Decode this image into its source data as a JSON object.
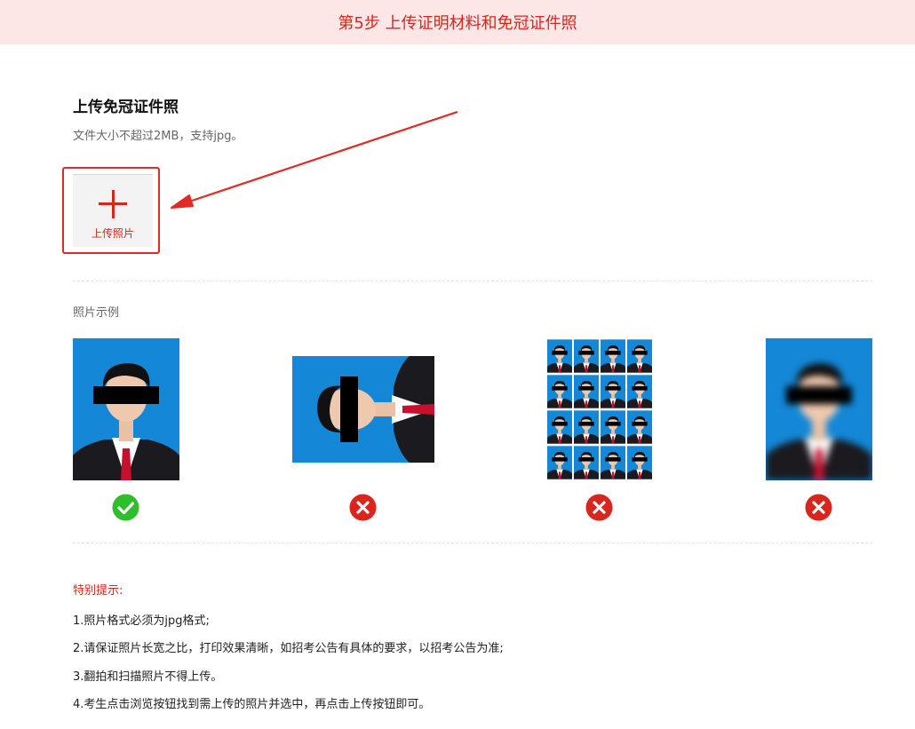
{
  "banner": {
    "title": "第5步 上传证明材料和免冠证件照"
  },
  "upload_section": {
    "title": "上传免冠证件照",
    "subtitle": "文件大小不超过2MB，支持jpg。",
    "upload_button_label": "上传照片",
    "plus_icon": "plus-icon"
  },
  "examples": {
    "title": "照片示例",
    "items": [
      {
        "name": "upright-photo",
        "status": "correct",
        "status_icon": "check-circle-icon",
        "status_color": "#2fbe2b"
      },
      {
        "name": "rotated-photo",
        "status": "wrong",
        "status_icon": "x-circle-icon",
        "status_color": "#d9251c"
      },
      {
        "name": "photo-sheet-grid",
        "status": "wrong",
        "status_icon": "x-circle-icon",
        "status_color": "#d9251c"
      },
      {
        "name": "blurry-photo",
        "status": "wrong",
        "status_icon": "x-circle-icon",
        "status_color": "#d9251c"
      }
    ]
  },
  "tips": {
    "title": "特别提示:",
    "items": [
      "1.照片格式必须为jpg格式;",
      "2.请保证照片长宽之比，打印效果清晰，如招考公告有具体的要求，以招考公告为准;",
      "3.翻拍和扫描照片不得上传。",
      "4.考生点击浏览按钮找到需上传的照片并选中，再点击上传按钮即可。"
    ]
  },
  "colors": {
    "accent": "#d9251c",
    "banner_bg": "#fde6e6",
    "photo_bg": "#1487d6",
    "ok": "#2fbe2b"
  }
}
